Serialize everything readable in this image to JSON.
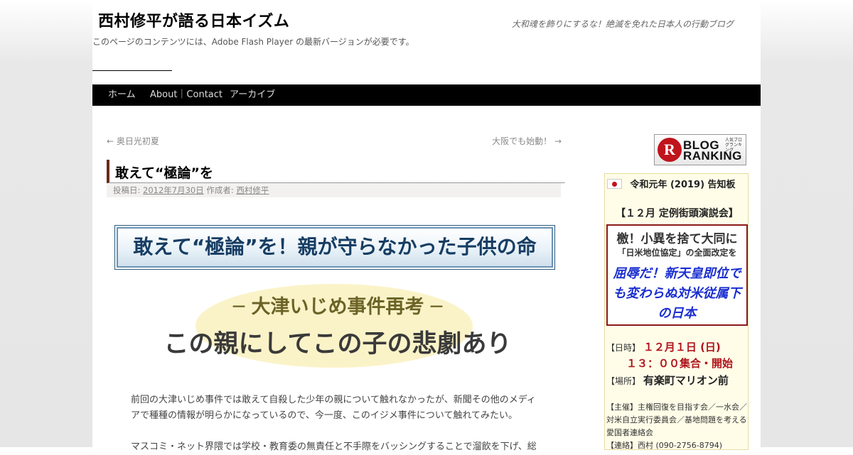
{
  "site": {
    "title": "西村修平が語る日本イズム",
    "description": "大和魂を飾りにするな！絶滅を免れた日本人の行動ブログ",
    "flash_note": "このページのコンテンツには、Adobe Flash Player の最新バージョンが必要です。"
  },
  "nav": {
    "items": [
      "ホーム",
      "About｜Contact",
      "アーカイブ"
    ]
  },
  "post_nav": {
    "prev": "← 奥日光初夏",
    "next": "大阪でも始動！ →"
  },
  "entry": {
    "title": "敢えて“極論”を",
    "meta_posted": "投稿日:",
    "meta_date": "2012年7月30日",
    "meta_author_label": "作成者:",
    "meta_author": "西村修平",
    "banner": "敢えて“極論”を！親が守らなかった子供の命",
    "subtitle1": "─ 大津いじめ事件再考 ─",
    "subtitle2": "この親にしてこの子の悲劇あり",
    "paragraph1": "前回の大津いじめ事件では敢えて自殺した少年の親について触れなかったが、新聞その他のメディアで種種の情報が明らかになっているので、今一度、このイジメ事件について触れてみたい。",
    "paragraph2": "マスコミ・ネット界隈では学校・教育委の無責任と不手際をバッシングすることで溜飲を下げ、総"
  },
  "sidebar": {
    "ranking": {
      "letter": "R",
      "line1": "BLOG",
      "line2": "RANKING",
      "small": "人気ブログランキング"
    },
    "notice": {
      "title": "令和元年 (2019) 告知板",
      "event": "【１２月 定例街頭演説会】",
      "box_line1": "檄！小異を捨て大同に",
      "box_line2": "「日米地位協定」の全面改定を",
      "box_line3": "屈辱だ！新天皇即位でも変わらぬ対米従属下の日本",
      "date_label": "【日時】",
      "date_value": "１２月１日 (日)",
      "time_value": "１３：００集合・開始",
      "place_label": "【場所】",
      "place_value": "有楽町マリオン前",
      "sponsor": "【主催】主権回復を目指す会／一水会／対米自立実行委員会／基地問題を考える愛国者連絡会",
      "contact": "【連絡】西村 (090-2756-8794)"
    }
  },
  "colors": {
    "nav_bg": "#000000",
    "title_accent": "#6b2a1a",
    "banner_text": "#163d63",
    "notice_red": "#b0141c",
    "notice_blue": "#1a2ed0"
  }
}
